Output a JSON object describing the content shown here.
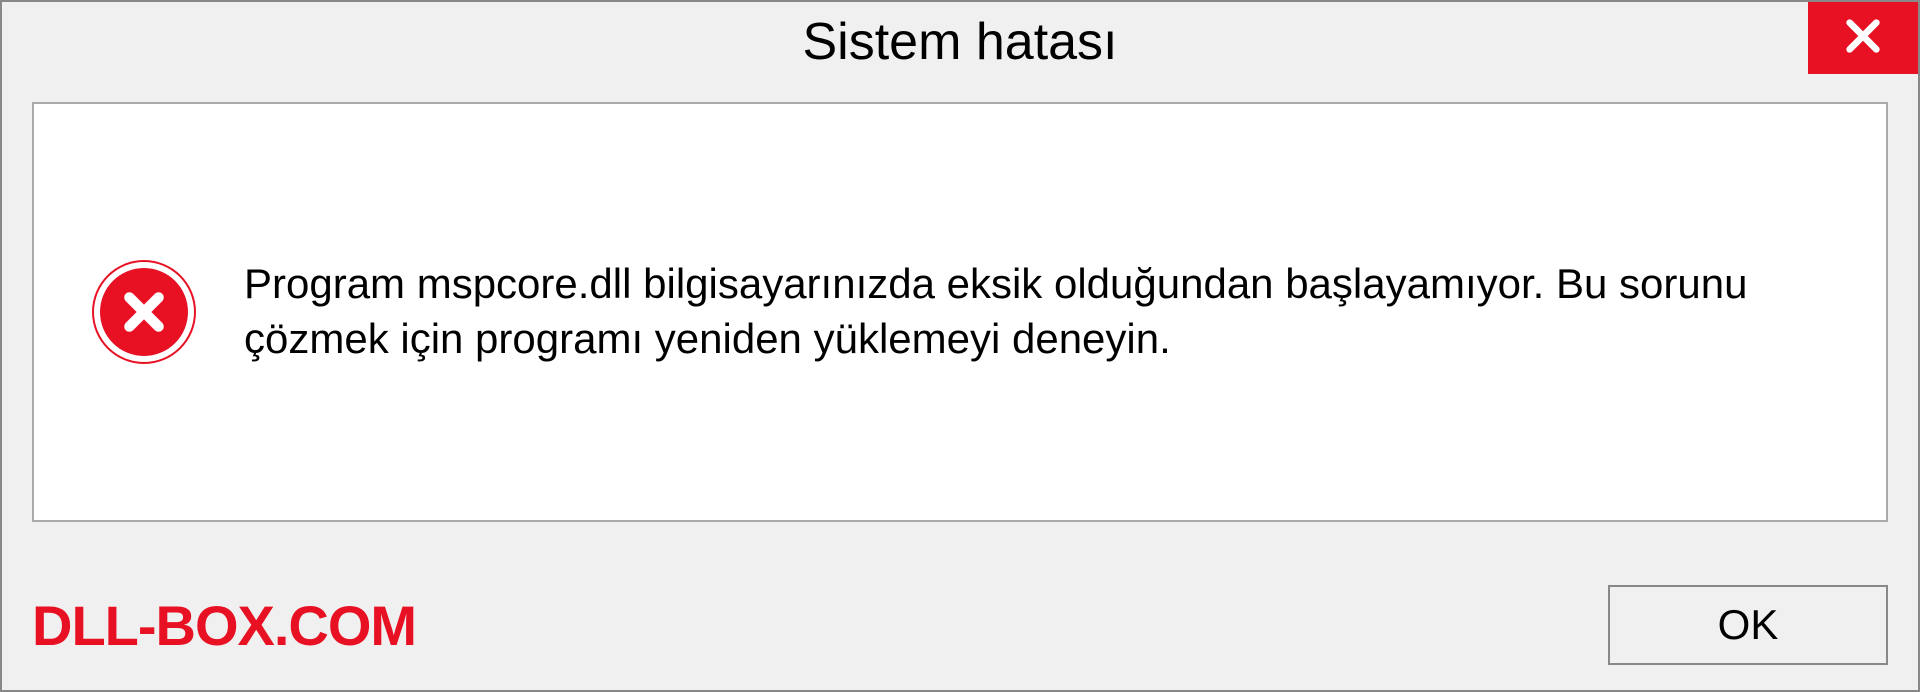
{
  "titlebar": {
    "title": "Sistem hatası"
  },
  "content": {
    "message": "Program mspcore.dll bilgisayarınızda eksik olduğundan başlayamıyor. Bu sorunu çözmek için programı yeniden yüklemeyi deneyin."
  },
  "footer": {
    "watermark": "DLL-BOX.COM",
    "ok_label": "OK"
  }
}
